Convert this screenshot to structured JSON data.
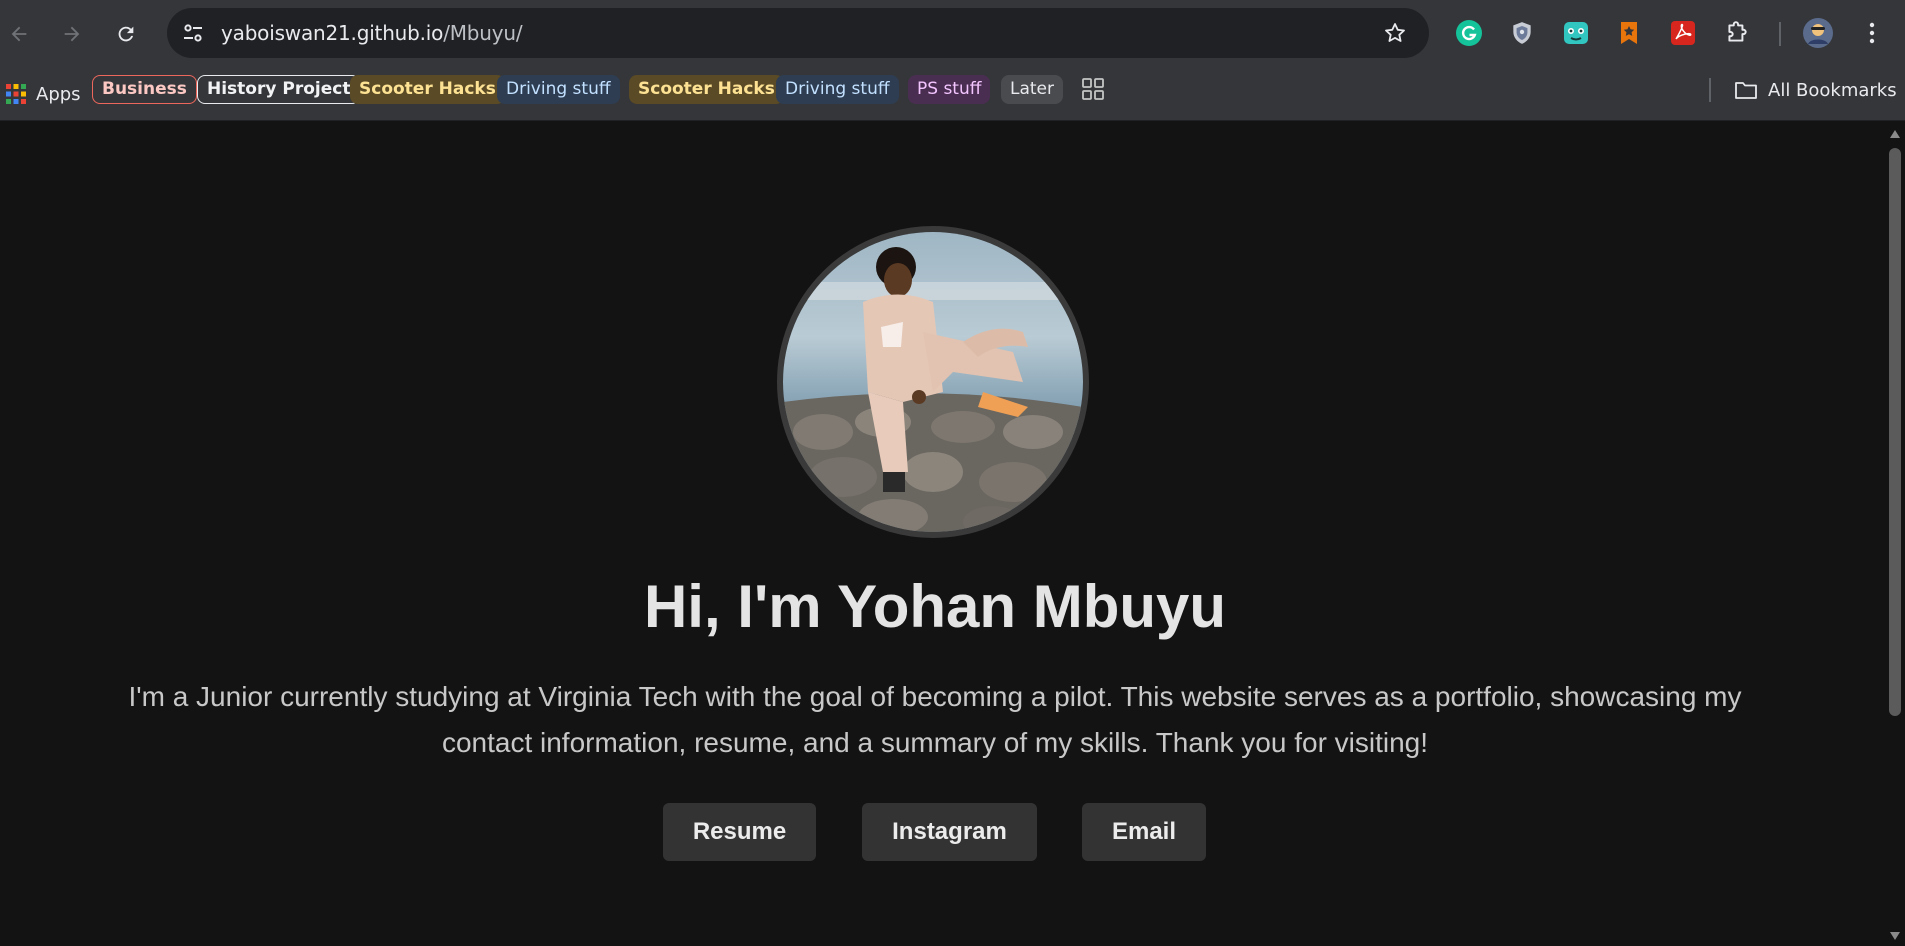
{
  "browser": {
    "url_host": "yaboiswan21.github.io",
    "url_path": "/Mbuyu/",
    "apps_label": "Apps",
    "all_bookmarks_label": "All Bookmarks",
    "bookmarks": [
      {
        "label": "Business",
        "style": "red"
      },
      {
        "label": "History Project",
        "style": "white"
      },
      {
        "label": "Scooter Hacks",
        "style": "yellow"
      },
      {
        "label": "Driving stuff",
        "style": "blue"
      },
      {
        "label": "Scooter Hacks",
        "style": "yellow"
      },
      {
        "label": "Driving stuff",
        "style": "blue"
      },
      {
        "label": "PS stuff",
        "style": "purple"
      },
      {
        "label": "Later",
        "style": "grey"
      }
    ],
    "extensions": [
      "grammarly-icon",
      "shield-icon",
      "robot-icon",
      "bookmark-icon",
      "pdf-icon",
      "puzzle-icon"
    ]
  },
  "page": {
    "heading": "Hi, I'm Yohan Mbuyu",
    "intro_line1": "I'm a Junior currently studying at Virginia Tech with the goal of becoming a pilot. This website serves as a portfolio, showcasing my",
    "intro_line2": "contact information, resume, and a summary of my skills. Thank you for visiting!",
    "buttons": {
      "resume": "Resume",
      "instagram": "Instagram",
      "email": "Email"
    }
  },
  "colors": {
    "page_bg": "#131313",
    "chrome_bg": "#35363a",
    "button_bg": "#333333"
  }
}
